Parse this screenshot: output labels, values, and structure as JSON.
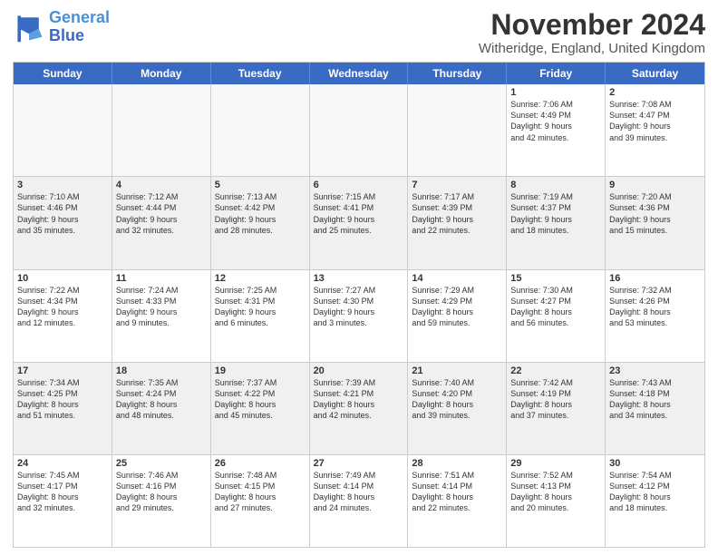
{
  "logo": {
    "line1": "General",
    "line2": "Blue"
  },
  "title": "November 2024",
  "location": "Witheridge, England, United Kingdom",
  "days_of_week": [
    "Sunday",
    "Monday",
    "Tuesday",
    "Wednesday",
    "Thursday",
    "Friday",
    "Saturday"
  ],
  "weeks": [
    [
      {
        "day": "",
        "info": "",
        "empty": true
      },
      {
        "day": "",
        "info": "",
        "empty": true
      },
      {
        "day": "",
        "info": "",
        "empty": true
      },
      {
        "day": "",
        "info": "",
        "empty": true
      },
      {
        "day": "",
        "info": "",
        "empty": true
      },
      {
        "day": "1",
        "info": "Sunrise: 7:06 AM\nSunset: 4:49 PM\nDaylight: 9 hours\nand 42 minutes.",
        "empty": false
      },
      {
        "day": "2",
        "info": "Sunrise: 7:08 AM\nSunset: 4:47 PM\nDaylight: 9 hours\nand 39 minutes.",
        "empty": false
      }
    ],
    [
      {
        "day": "3",
        "info": "Sunrise: 7:10 AM\nSunset: 4:46 PM\nDaylight: 9 hours\nand 35 minutes.",
        "empty": false
      },
      {
        "day": "4",
        "info": "Sunrise: 7:12 AM\nSunset: 4:44 PM\nDaylight: 9 hours\nand 32 minutes.",
        "empty": false
      },
      {
        "day": "5",
        "info": "Sunrise: 7:13 AM\nSunset: 4:42 PM\nDaylight: 9 hours\nand 28 minutes.",
        "empty": false
      },
      {
        "day": "6",
        "info": "Sunrise: 7:15 AM\nSunset: 4:41 PM\nDaylight: 9 hours\nand 25 minutes.",
        "empty": false
      },
      {
        "day": "7",
        "info": "Sunrise: 7:17 AM\nSunset: 4:39 PM\nDaylight: 9 hours\nand 22 minutes.",
        "empty": false
      },
      {
        "day": "8",
        "info": "Sunrise: 7:19 AM\nSunset: 4:37 PM\nDaylight: 9 hours\nand 18 minutes.",
        "empty": false
      },
      {
        "day": "9",
        "info": "Sunrise: 7:20 AM\nSunset: 4:36 PM\nDaylight: 9 hours\nand 15 minutes.",
        "empty": false
      }
    ],
    [
      {
        "day": "10",
        "info": "Sunrise: 7:22 AM\nSunset: 4:34 PM\nDaylight: 9 hours\nand 12 minutes.",
        "empty": false
      },
      {
        "day": "11",
        "info": "Sunrise: 7:24 AM\nSunset: 4:33 PM\nDaylight: 9 hours\nand 9 minutes.",
        "empty": false
      },
      {
        "day": "12",
        "info": "Sunrise: 7:25 AM\nSunset: 4:31 PM\nDaylight: 9 hours\nand 6 minutes.",
        "empty": false
      },
      {
        "day": "13",
        "info": "Sunrise: 7:27 AM\nSunset: 4:30 PM\nDaylight: 9 hours\nand 3 minutes.",
        "empty": false
      },
      {
        "day": "14",
        "info": "Sunrise: 7:29 AM\nSunset: 4:29 PM\nDaylight: 8 hours\nand 59 minutes.",
        "empty": false
      },
      {
        "day": "15",
        "info": "Sunrise: 7:30 AM\nSunset: 4:27 PM\nDaylight: 8 hours\nand 56 minutes.",
        "empty": false
      },
      {
        "day": "16",
        "info": "Sunrise: 7:32 AM\nSunset: 4:26 PM\nDaylight: 8 hours\nand 53 minutes.",
        "empty": false
      }
    ],
    [
      {
        "day": "17",
        "info": "Sunrise: 7:34 AM\nSunset: 4:25 PM\nDaylight: 8 hours\nand 51 minutes.",
        "empty": false
      },
      {
        "day": "18",
        "info": "Sunrise: 7:35 AM\nSunset: 4:24 PM\nDaylight: 8 hours\nand 48 minutes.",
        "empty": false
      },
      {
        "day": "19",
        "info": "Sunrise: 7:37 AM\nSunset: 4:22 PM\nDaylight: 8 hours\nand 45 minutes.",
        "empty": false
      },
      {
        "day": "20",
        "info": "Sunrise: 7:39 AM\nSunset: 4:21 PM\nDaylight: 8 hours\nand 42 minutes.",
        "empty": false
      },
      {
        "day": "21",
        "info": "Sunrise: 7:40 AM\nSunset: 4:20 PM\nDaylight: 8 hours\nand 39 minutes.",
        "empty": false
      },
      {
        "day": "22",
        "info": "Sunrise: 7:42 AM\nSunset: 4:19 PM\nDaylight: 8 hours\nand 37 minutes.",
        "empty": false
      },
      {
        "day": "23",
        "info": "Sunrise: 7:43 AM\nSunset: 4:18 PM\nDaylight: 8 hours\nand 34 minutes.",
        "empty": false
      }
    ],
    [
      {
        "day": "24",
        "info": "Sunrise: 7:45 AM\nSunset: 4:17 PM\nDaylight: 8 hours\nand 32 minutes.",
        "empty": false
      },
      {
        "day": "25",
        "info": "Sunrise: 7:46 AM\nSunset: 4:16 PM\nDaylight: 8 hours\nand 29 minutes.",
        "empty": false
      },
      {
        "day": "26",
        "info": "Sunrise: 7:48 AM\nSunset: 4:15 PM\nDaylight: 8 hours\nand 27 minutes.",
        "empty": false
      },
      {
        "day": "27",
        "info": "Sunrise: 7:49 AM\nSunset: 4:14 PM\nDaylight: 8 hours\nand 24 minutes.",
        "empty": false
      },
      {
        "day": "28",
        "info": "Sunrise: 7:51 AM\nSunset: 4:14 PM\nDaylight: 8 hours\nand 22 minutes.",
        "empty": false
      },
      {
        "day": "29",
        "info": "Sunrise: 7:52 AM\nSunset: 4:13 PM\nDaylight: 8 hours\nand 20 minutes.",
        "empty": false
      },
      {
        "day": "30",
        "info": "Sunrise: 7:54 AM\nSunset: 4:12 PM\nDaylight: 8 hours\nand 18 minutes.",
        "empty": false
      }
    ]
  ]
}
